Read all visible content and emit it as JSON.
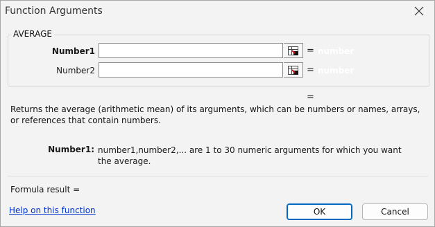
{
  "window": {
    "title": "Function Arguments",
    "close_icon": "close-icon"
  },
  "function_group": {
    "name": "AVERAGE",
    "args": [
      {
        "label": "Number1",
        "bold": true,
        "value": "",
        "eq": "=",
        "result": "number"
      },
      {
        "label": "Number2",
        "bold": false,
        "value": "",
        "eq": "=",
        "result": "number"
      }
    ],
    "result_eq": "="
  },
  "description": "Returns the average (arithmetic mean) of its arguments, which can be numbers or names, arrays, or references that contain numbers.",
  "arg_help": {
    "label": "Number1:",
    "text": "number1,number2,... are 1 to 30 numeric arguments for which you want the average."
  },
  "formula_result": "Formula result =",
  "help_link": "Help on this function",
  "buttons": {
    "ok": "OK",
    "cancel": "Cancel"
  },
  "colors": {
    "accent": "#0067c0",
    "link": "#0033cc",
    "background": "#f3f3f3"
  }
}
